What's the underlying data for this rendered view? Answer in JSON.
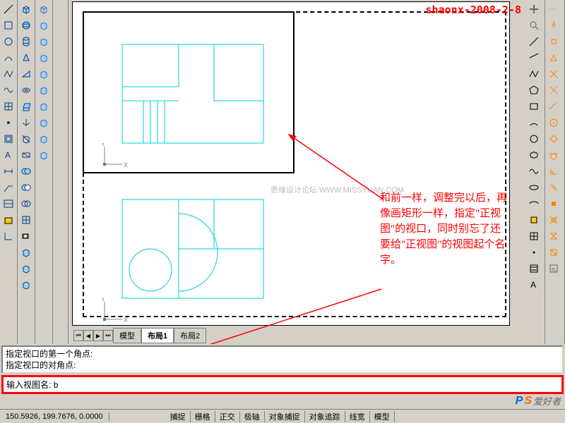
{
  "header_stamp": "shaonx-2008-2-8",
  "watermark_center": "思缘设计论坛  WWW.MISSYUAN.COM",
  "tabs": {
    "model": "模型",
    "layout1": "布局1",
    "layout2": "布局2"
  },
  "command": {
    "line1": "指定视口的第一个角点:",
    "line2": "指定视口的对角点:",
    "prompt": "输入视图名:",
    "value": "b"
  },
  "status": {
    "coords": "150.5926, 199.7676, 0.0000",
    "snap": "捕捉",
    "grid": "栅格",
    "ortho": "正交",
    "polar": "极轴",
    "osnap": "对象捕捉",
    "otrack": "对象追踪",
    "lweight": "线宽",
    "model": "模型"
  },
  "annotation": {
    "text": "和前一样，调整完以后，再像画矩形一样，指定\"正视图\"的视口，同时别忘了还要给\"正视图\"的视图起个名字。"
  },
  "logo": {
    "p": "P",
    "s": "S",
    "txt": "爱好者"
  },
  "axis": {
    "x": "X",
    "y": "Y"
  },
  "icons": {
    "col1": [
      "line",
      "box",
      "circle",
      "arc",
      "pline",
      "spline",
      "hatch",
      "point",
      "region",
      "text",
      "mtext",
      "dim",
      "leader",
      "table",
      "block"
    ],
    "col2": [
      "cube3d",
      "sphere",
      "cylinder",
      "cone",
      "wedge",
      "torus",
      "extrude",
      "revolve",
      "slice",
      "section",
      "union",
      "subtract",
      "intersect",
      "mesh",
      "camera",
      "cube-a",
      "cube-b",
      "cube-c"
    ],
    "col3": [
      "iso-a",
      "iso-b",
      "iso-c",
      "iso-d",
      "iso-e",
      "iso-f",
      "iso-g",
      "iso-h",
      "iso-i",
      "iso-j"
    ],
    "right1": [
      "pan",
      "zoom",
      "zoom-win",
      "zoom-ext",
      "line2",
      "arc2",
      "circle2",
      "ellipse",
      "poly",
      "rect",
      "rev-cloud",
      "spline2",
      "donut",
      "multi",
      "para",
      "cross",
      "text2",
      "grid-shape"
    ],
    "right2": [
      "cursor",
      "node",
      "tri",
      "tri2",
      "rotate",
      "scale",
      "hatch2",
      "offset",
      "center",
      "perp",
      "text3"
    ]
  }
}
